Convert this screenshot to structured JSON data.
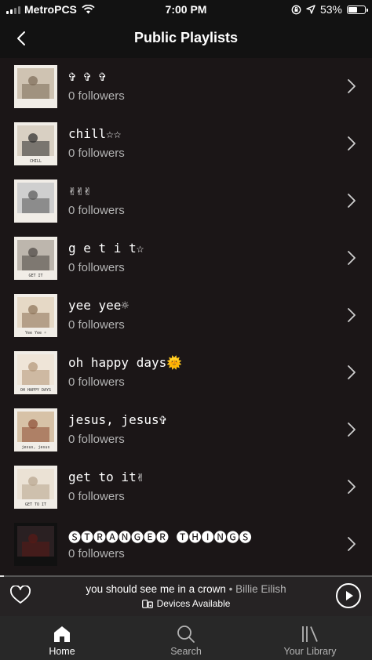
{
  "status_bar": {
    "carrier": "MetroPCS",
    "time": "7:00 PM",
    "battery": "53%",
    "battery_level": 0.53
  },
  "header": {
    "title": "Public Playlists"
  },
  "playlists": [
    {
      "name": "✞ ✞ ✞",
      "followers": "0 followers",
      "cover_caption": "",
      "tone": [
        "#7a6a55",
        "#cfc3b2"
      ]
    },
    {
      "name": "chill☆☆",
      "followers": "0 followers",
      "cover_caption": "CHILL",
      "tone": [
        "#2a2a2a",
        "#d9d0c3"
      ]
    },
    {
      "name": "✌✌✌",
      "followers": "0 followers",
      "cover_caption": "",
      "tone": [
        "#555",
        "#cfcfcf"
      ]
    },
    {
      "name": "g e t  i t☆",
      "followers": "0 followers",
      "cover_caption": "GET IT",
      "tone": [
        "#4a4540",
        "#bdb6ad"
      ]
    },
    {
      "name": "yee yee☼",
      "followers": "0 followers",
      "cover_caption": "Yee Yee ☼",
      "tone": [
        "#8a7055",
        "#e6d9c6"
      ]
    },
    {
      "name": "oh happy days🌞",
      "followers": "0 followers",
      "cover_caption": "OH HAPPY DAYS",
      "tone": [
        "#b29677",
        "#efe5d8"
      ]
    },
    {
      "name": "jesus, jesus✞",
      "followers": "0 followers",
      "cover_caption": "jesus, jesus",
      "tone": [
        "#8c4a32",
        "#d7c2a7"
      ]
    },
    {
      "name": "get to it✌",
      "followers": "0 followers",
      "cover_caption": "GET TO IT",
      "tone": [
        "#b6a48c",
        "#ebe2d5"
      ]
    },
    {
      "name": "🅢🅣🅡🅐🅝🅖🅔🅡 🅣🅗🅘🅝🅖🅢",
      "followers": "0 followers",
      "cover_caption": "",
      "tone": [
        "#5a1a16",
        "#2a2022"
      ]
    }
  ],
  "now_playing": {
    "track": "you should see me in a crown",
    "separator": " • ",
    "artist": "Billie Eilish",
    "devices": "Devices Available",
    "progress": 0.01
  },
  "tabs": [
    {
      "label": "Home",
      "icon": "home-icon",
      "active": true
    },
    {
      "label": "Search",
      "icon": "search-icon",
      "active": false
    },
    {
      "label": "Your Library",
      "icon": "library-icon",
      "active": false
    }
  ],
  "colors": {
    "background": "#1b1617",
    "header": "#121212",
    "player_bar": "#262324",
    "tab_bar": "#282828",
    "secondary_text": "#b3b3b3"
  }
}
